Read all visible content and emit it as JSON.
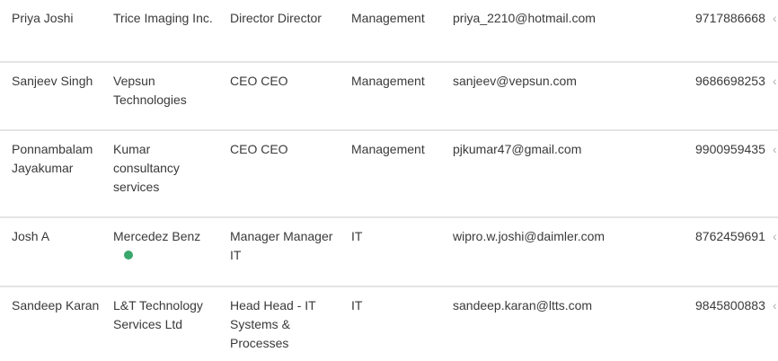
{
  "rows": [
    {
      "name": "Priya Joshi",
      "company": "Trice Imaging Inc.",
      "designation": "Director Director",
      "department": "Management",
      "email": "priya_2210@hotmail.com",
      "phone": "9717886668",
      "online": false
    },
    {
      "name": "Sanjeev Singh",
      "company": "Vepsun Technologies",
      "designation": "CEO CEO",
      "department": "Management",
      "email": "sanjeev@vepsun.com",
      "phone": "9686698253",
      "online": false
    },
    {
      "name": "Ponnambalam Jayakumar",
      "company": "Kumar consultancy services",
      "designation": "CEO CEO",
      "department": "Management",
      "email": "pjkumar47@gmail.com",
      "phone": "9900959435",
      "online": false
    },
    {
      "name": "Josh A",
      "company": "Mercedez Benz",
      "designation": "Manager Manager IT",
      "department": "IT",
      "email": "wipro.w.joshi@daimler.com",
      "phone": "8762459691",
      "online": true
    },
    {
      "name": "Sandeep Karan",
      "company": "L&T Technology Services Ltd",
      "designation": "Head Head - IT Systems & Processes",
      "department": "IT",
      "email": "sandeep.karan@ltts.com",
      "phone": "9845800883",
      "online": false
    }
  ],
  "more_glyph": "‹",
  "colors": {
    "text": "#3a3a3a",
    "divider": "#e4e4e4",
    "online_dot": "#3aa76d"
  }
}
